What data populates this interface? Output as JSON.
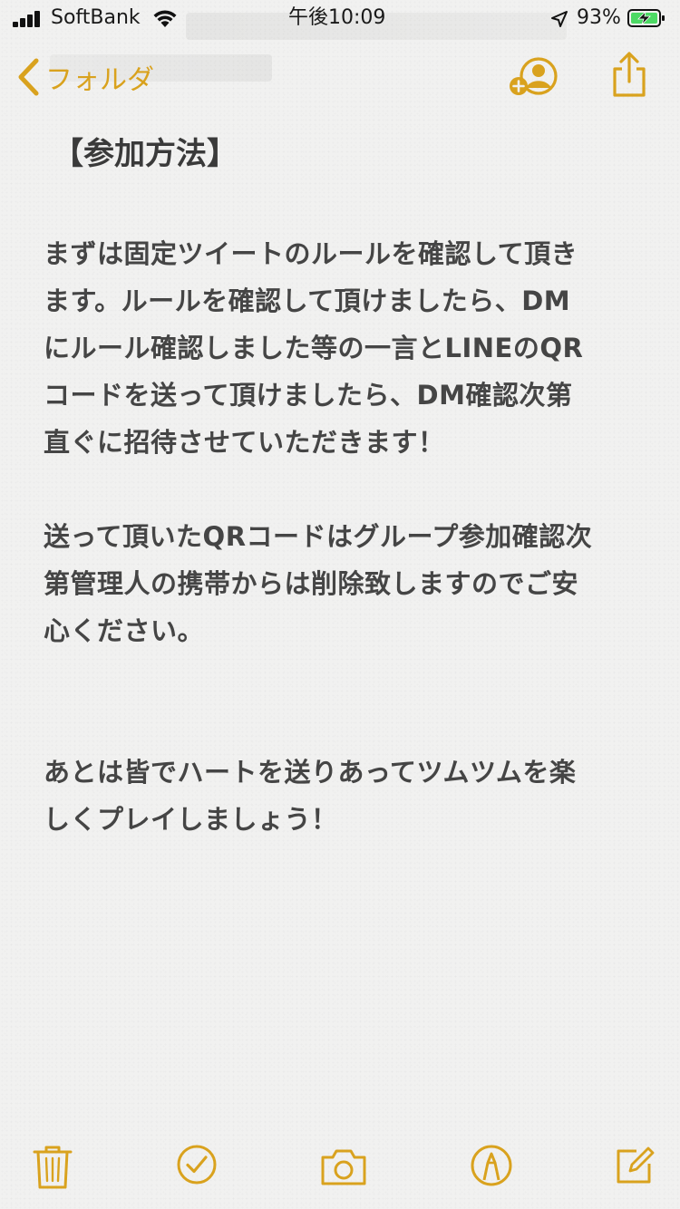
{
  "status": {
    "carrier": "SoftBank",
    "time": "午後10:09",
    "battery": "93%"
  },
  "nav": {
    "back_label": "フォルダ"
  },
  "note": {
    "title": "【参加方法】",
    "paragraph1": "まずは固定ツイートのルールを確認して頂き\nます。ルールを確認して頂けましたら、DM\nにルール確認しました等の一言とLINEのQR\nコードを送って頂けましたら、DM確認次第\n直ぐに招待させていただきます！",
    "paragraph2": "送って頂いたQRコードはグループ参加確認次\n第管理人の携帯からは削除致しますのでご安\n心ください。",
    "paragraph3": "あとは皆でハートを送りあってツムツムを楽\nしくプレイしましょう！"
  },
  "icons": {
    "back": "chevron-left-icon",
    "share_note": "add-person-icon",
    "export": "share-icon",
    "trash": "trash-icon",
    "checklist": "checkmark-circle-icon",
    "camera": "camera-icon",
    "markup": "pen-tip-circle-icon",
    "compose": "compose-icon"
  },
  "colors": {
    "accent": "#d9a21e",
    "text": "#454545",
    "background": "#f1f1f0",
    "battery_fill": "#4cd964"
  }
}
